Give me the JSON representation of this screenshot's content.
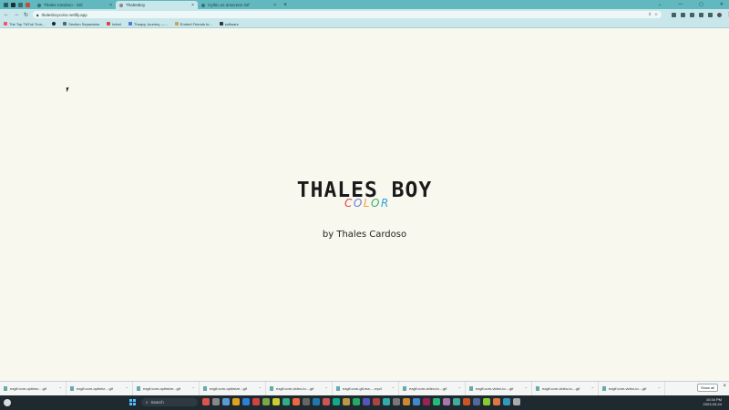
{
  "browser": {
    "tabs": [
      {
        "label": "Thales Cardoso - Gitl",
        "active": false
      },
      {
        "label": "ThalesBoy",
        "active": true
      },
      {
        "label": "Cythic.us anscreen GIf",
        "active": false
      }
    ],
    "new_tab_label": "+",
    "close_label": "×",
    "window_controls": [
      "⌄",
      "—",
      "▢",
      "✕"
    ],
    "nav": {
      "back": "←",
      "forward": "→",
      "reload": "↻"
    },
    "address": "thalesboycolor.netlify.app",
    "bookmarks": [
      "The Top TikTok Trnn...",
      "Section Separators",
      "krkml",
      "Thaqcy Journey —...",
      "Embed Friends fo...",
      "software"
    ]
  },
  "page": {
    "title": "THALES BOY",
    "subtitle_letters": [
      {
        "char": "C",
        "color": "#e04545"
      },
      {
        "char": "O",
        "color": "#6f7fd8"
      },
      {
        "char": "L",
        "color": "#f3a040"
      },
      {
        "char": "O",
        "color": "#45b06a"
      },
      {
        "char": "R",
        "color": "#2ba3d8"
      }
    ],
    "byline": "by Thales Cardoso"
  },
  "downloads": {
    "items": [
      "ezgif.com-optimiz....gif",
      "ezgif.com-optimiz....gif",
      "ezgif.com-optimize...gif",
      "ezgif.com-optimize...gif",
      "ezgif.com-video-to....gif",
      "ezgif.com-gif-ma.....mp4",
      "ezgif.com-video-to....gif",
      "ezgif.com-video-to....gif",
      "ezgif.com-video-to....gif",
      "ezgif.com-video-to....gif"
    ],
    "show_all_label": "Show all"
  },
  "taskbar": {
    "search_label": "Search",
    "time": "10:34 PM",
    "date": "2023-03-24",
    "icon_colors": [
      "#d9534f",
      "#888",
      "#5b9bd5",
      "#e0a020",
      "#2f7fd6",
      "#c44",
      "#7a4",
      "#cc3",
      "#3a8",
      "#e64",
      "#666",
      "#27a",
      "#c55",
      "#1a8",
      "#b94",
      "#2a6",
      "#55b",
      "#a44",
      "#3aa",
      "#777",
      "#c83",
      "#48c",
      "#925",
      "#2b7",
      "#a7a",
      "#4a9",
      "#c52",
      "#569",
      "#8c3",
      "#d74",
      "#39b",
      "#aaa"
    ],
    "accent": "#4ec0ff"
  }
}
